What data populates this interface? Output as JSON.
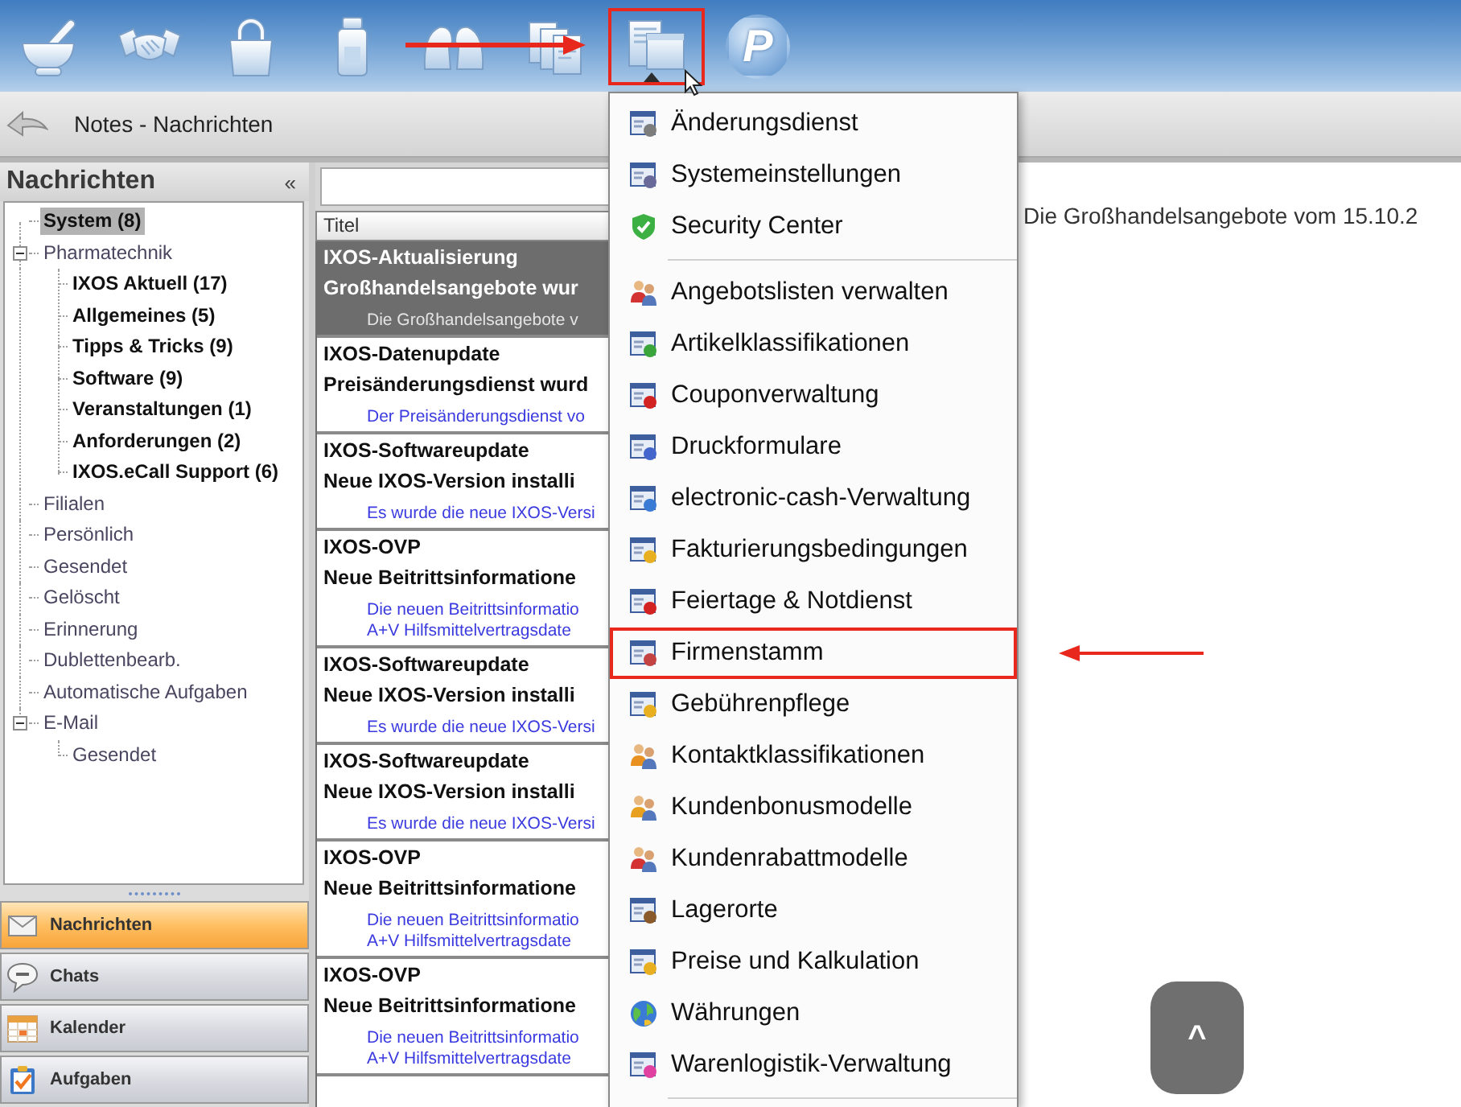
{
  "toolbar": {
    "items": [
      {
        "annotated": false,
        "open": false
      },
      {
        "annotated": false,
        "open": false
      },
      {
        "annotated": false,
        "open": false
      },
      {
        "annotated": false,
        "open": false
      },
      {
        "annotated": false,
        "open": false
      },
      {
        "annotated": false,
        "open": false
      },
      {
        "annotated": true,
        "open": true
      },
      {
        "glyph": "P",
        "annotated": false,
        "open": false
      }
    ]
  },
  "header": {
    "title": "Notes - Nachrichten"
  },
  "sidebar": {
    "title": "Nachrichten",
    "collapse_glyph": "«",
    "tree": [
      {
        "label": "System (8)",
        "unread": true,
        "selected": true
      },
      {
        "label": "Pharmatechnik",
        "unread": false,
        "selected": false,
        "expanded": true,
        "children": [
          {
            "label": "IXOS Aktuell (17)",
            "unread": true,
            "selected": false
          },
          {
            "label": "Allgemeines (5)",
            "unread": true,
            "selected": false
          },
          {
            "label": "Tipps & Tricks (9)",
            "unread": true,
            "selected": false
          },
          {
            "label": "Software (9)",
            "unread": true,
            "selected": false
          },
          {
            "label": "Veranstaltungen (1)",
            "unread": true,
            "selected": false
          },
          {
            "label": "Anforderungen (2)",
            "unread": true,
            "selected": false
          },
          {
            "label": "IXOS.eCall Support (6)",
            "unread": true,
            "selected": false
          }
        ]
      },
      {
        "label": "Filialen",
        "unread": false,
        "selected": false
      },
      {
        "label": "Persönlich",
        "unread": false,
        "selected": false
      },
      {
        "label": "Gesendet",
        "unread": false,
        "selected": false
      },
      {
        "label": "Gelöscht",
        "unread": false,
        "selected": false
      },
      {
        "label": "Erinnerung",
        "unread": false,
        "selected": false
      },
      {
        "label": "Dublettenbearb.",
        "unread": false,
        "selected": false
      },
      {
        "label": "Automatische Aufgaben",
        "unread": false,
        "selected": false
      },
      {
        "label": "E-Mail",
        "unread": false,
        "selected": false,
        "expanded": true,
        "children": [
          {
            "label": "Gesendet",
            "unread": false,
            "selected": false
          }
        ]
      }
    ],
    "nav": [
      {
        "label": "Nachrichten",
        "selected": true
      },
      {
        "label": "Chats",
        "selected": false
      },
      {
        "label": "Kalender",
        "selected": false
      },
      {
        "label": "Aufgaben",
        "selected": false
      }
    ]
  },
  "message_list": {
    "column": "Titel",
    "rows": [
      {
        "title": "IXOS-Aktualisierung",
        "subject": "Großhandelsangebote wur",
        "preview": [
          "Die Großhandelsangebote v"
        ],
        "selected": true
      },
      {
        "title": "IXOS-Datenupdate",
        "subject": "Preisänderungsdienst wurd",
        "preview": [
          "Der Preisänderungsdienst vo"
        ],
        "selected": false
      },
      {
        "title": "IXOS-Softwareupdate",
        "subject": "Neue IXOS-Version installi",
        "preview": [
          "Es wurde die neue IXOS-Versi"
        ],
        "selected": false
      },
      {
        "title": "IXOS-OVP",
        "subject": "Neue Beitrittsinformatione",
        "preview": [
          "Die neuen Beitrittsinformatio",
          "A+V Hilfsmittelvertragsdate"
        ],
        "selected": false
      },
      {
        "title": "IXOS-Softwareupdate",
        "subject": "Neue IXOS-Version installi",
        "preview": [
          "Es wurde die neue IXOS-Versi"
        ],
        "selected": false
      },
      {
        "title": "IXOS-Softwareupdate",
        "subject": "Neue IXOS-Version installi",
        "preview": [
          "Es wurde die neue IXOS-Versi"
        ],
        "selected": false
      },
      {
        "title": "IXOS-OVP",
        "subject": "Neue Beitrittsinformatione",
        "preview": [
          "Die neuen Beitrittsinformatio",
          "A+V Hilfsmittelvertragsdate"
        ],
        "selected": false
      },
      {
        "title": "IXOS-OVP",
        "subject": "Neue Beitrittsinformatione",
        "preview": [
          "Die neuen Beitrittsinformatio",
          "A+V Hilfsmittelvertragsdate"
        ],
        "selected": false
      }
    ]
  },
  "preview": {
    "text": "Die Großhandelsangebote vom 15.10.2"
  },
  "dropdown_menu": {
    "groups": [
      [
        {
          "label": "Änderungsdienst",
          "annotated": false
        },
        {
          "label": "Systemeinstellungen",
          "annotated": false
        },
        {
          "label": "Security Center",
          "annotated": false
        }
      ],
      [
        {
          "label": "Angebotslisten verwalten",
          "annotated": false
        },
        {
          "label": "Artikelklassifikationen",
          "annotated": false
        },
        {
          "label": "Couponverwaltung",
          "annotated": false
        },
        {
          "label": "Druckformulare",
          "annotated": false
        },
        {
          "label": "electronic-cash-Verwaltung",
          "annotated": false
        },
        {
          "label": "Fakturierungsbedingungen",
          "annotated": false
        },
        {
          "label": "Feiertage & Notdienst",
          "annotated": false
        },
        {
          "label": "Firmenstamm",
          "annotated": true
        },
        {
          "label": "Gebührenpflege",
          "annotated": false
        },
        {
          "label": "Kontaktklassifikationen",
          "annotated": false
        },
        {
          "label": "Kundenbonusmodelle",
          "annotated": false
        },
        {
          "label": "Kundenrabattmodelle",
          "annotated": false
        },
        {
          "label": "Lagerorte",
          "annotated": false
        },
        {
          "label": "Preise und Kalkulation",
          "annotated": false
        },
        {
          "label": "Währungen",
          "annotated": false
        },
        {
          "label": "Warenlogistik-Verwaltung",
          "annotated": false
        }
      ]
    ]
  },
  "scroll_top_button": {
    "label": "^"
  }
}
